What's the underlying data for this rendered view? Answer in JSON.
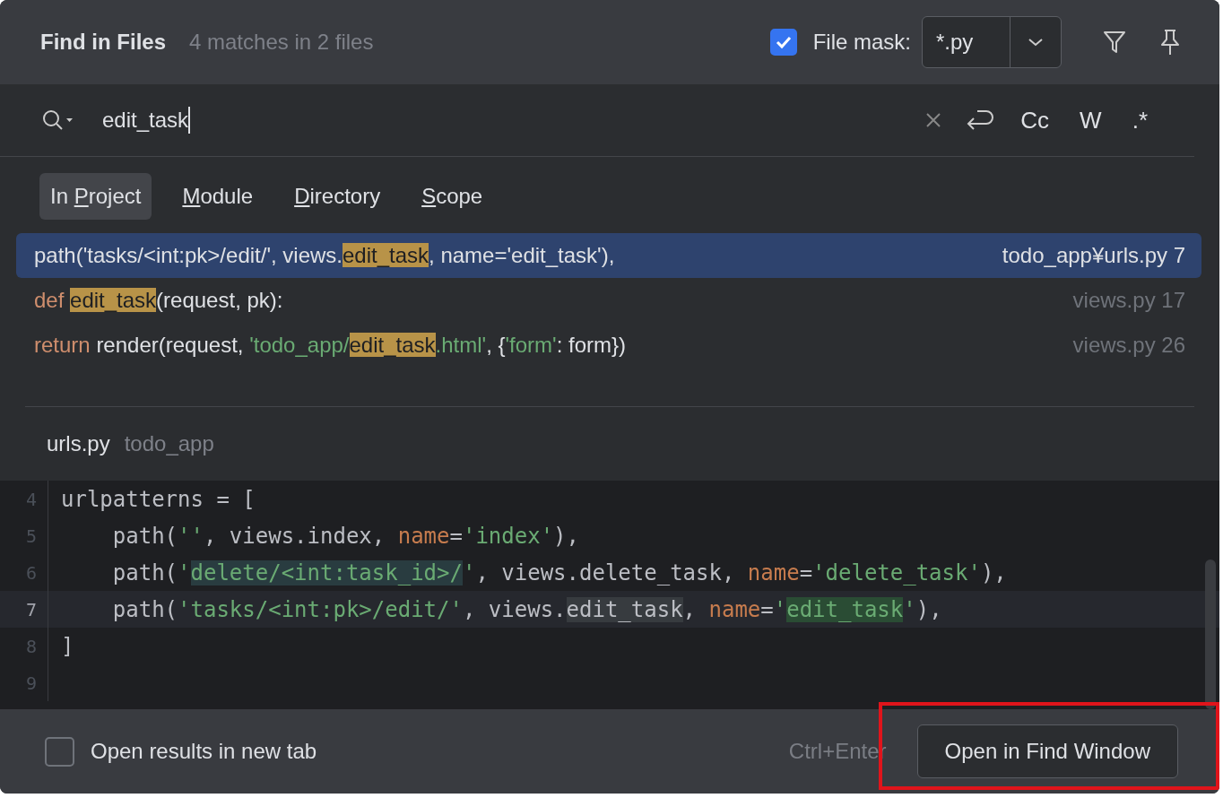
{
  "header": {
    "title": "Find in Files",
    "summary": "4 matches in 2 files",
    "file_mask": {
      "checked": true,
      "label": "File mask:",
      "value": "*.py"
    }
  },
  "search": {
    "value": "edit_task",
    "options": [
      "Cc",
      "W",
      ".*"
    ]
  },
  "scopes": [
    {
      "key": "P",
      "pre": "In ",
      "post": "roject",
      "selected": true
    },
    {
      "key": "M",
      "post": "odule",
      "selected": false
    },
    {
      "key": "D",
      "post": "irectory",
      "selected": false
    },
    {
      "key": "S",
      "post": "cope",
      "selected": false
    }
  ],
  "results": [
    {
      "selected": true,
      "file": "todo_app¥urls.py 7",
      "segments": [
        {
          "kind": "text",
          "text": "path('tasks/<int:pk>/edit/', views."
        },
        {
          "kind": "match",
          "text": "edit_task"
        },
        {
          "kind": "text",
          "text": ", name='edit_task'),"
        }
      ]
    },
    {
      "selected": false,
      "file": "views.py 17",
      "segments": [
        {
          "kind": "keyword",
          "text": "def "
        },
        {
          "kind": "match",
          "text": "edit_task"
        },
        {
          "kind": "text",
          "text": "(request, pk):"
        }
      ]
    },
    {
      "selected": false,
      "file": "views.py 26",
      "segments": [
        {
          "kind": "keyword",
          "text": "return "
        },
        {
          "kind": "text",
          "text": "render(request, "
        },
        {
          "kind": "string",
          "text": "'todo_app/"
        },
        {
          "kind": "match",
          "text": "edit_task"
        },
        {
          "kind": "string",
          "text": ".html'"
        },
        {
          "kind": "text",
          "text": ", {"
        },
        {
          "kind": "string",
          "text": "'form'"
        },
        {
          "kind": "text",
          "text": ": form})"
        }
      ]
    }
  ],
  "preview": {
    "file": "urls.py",
    "folder": "todo_app",
    "lines": [
      {
        "number": "4",
        "current": false,
        "tokens": [
          {
            "kind": "plain",
            "text": "urlpatterns = ["
          }
        ]
      },
      {
        "number": "5",
        "current": false,
        "tokens": [
          {
            "kind": "plain",
            "text": "    path("
          },
          {
            "kind": "string",
            "text": "''"
          },
          {
            "kind": "plain",
            "text": ", views.index, "
          },
          {
            "kind": "param",
            "text": "name"
          },
          {
            "kind": "plain",
            "text": "="
          },
          {
            "kind": "string",
            "text": "'index'"
          },
          {
            "kind": "plain",
            "text": "),"
          }
        ]
      },
      {
        "number": "6",
        "current": false,
        "tokens": [
          {
            "kind": "plain",
            "text": "    path("
          },
          {
            "kind": "string",
            "text": "'"
          },
          {
            "kind": "string-highlight",
            "text": "delete/<int:task_id>/"
          },
          {
            "kind": "string",
            "text": "'"
          },
          {
            "kind": "plain",
            "text": ", views.delete_task, "
          },
          {
            "kind": "param",
            "text": "name"
          },
          {
            "kind": "plain",
            "text": "="
          },
          {
            "kind": "string",
            "text": "'delete_task'"
          },
          {
            "kind": "plain",
            "text": "),"
          }
        ]
      },
      {
        "number": "7",
        "current": true,
        "tokens": [
          {
            "kind": "plain",
            "text": "    path("
          },
          {
            "kind": "string",
            "text": "'tasks/<int:pk>/edit/'"
          },
          {
            "kind": "plain",
            "text": ", views."
          },
          {
            "kind": "highlight",
            "text": "edit_task"
          },
          {
            "kind": "plain",
            "text": ", "
          },
          {
            "kind": "param",
            "text": "name"
          },
          {
            "kind": "plain",
            "text": "="
          },
          {
            "kind": "string",
            "text": "'"
          },
          {
            "kind": "match",
            "text": "edit_task"
          },
          {
            "kind": "string",
            "text": "'"
          },
          {
            "kind": "plain",
            "text": "),"
          }
        ]
      },
      {
        "number": "8",
        "current": false,
        "tokens": [
          {
            "kind": "plain",
            "text": "]"
          }
        ]
      },
      {
        "number": "9",
        "current": false
      }
    ]
  },
  "footer": {
    "new_tab": {
      "checked": false,
      "label": "Open results in new tab"
    },
    "shortcut": "Ctrl+Enter",
    "button": "Open in Find Window"
  }
}
